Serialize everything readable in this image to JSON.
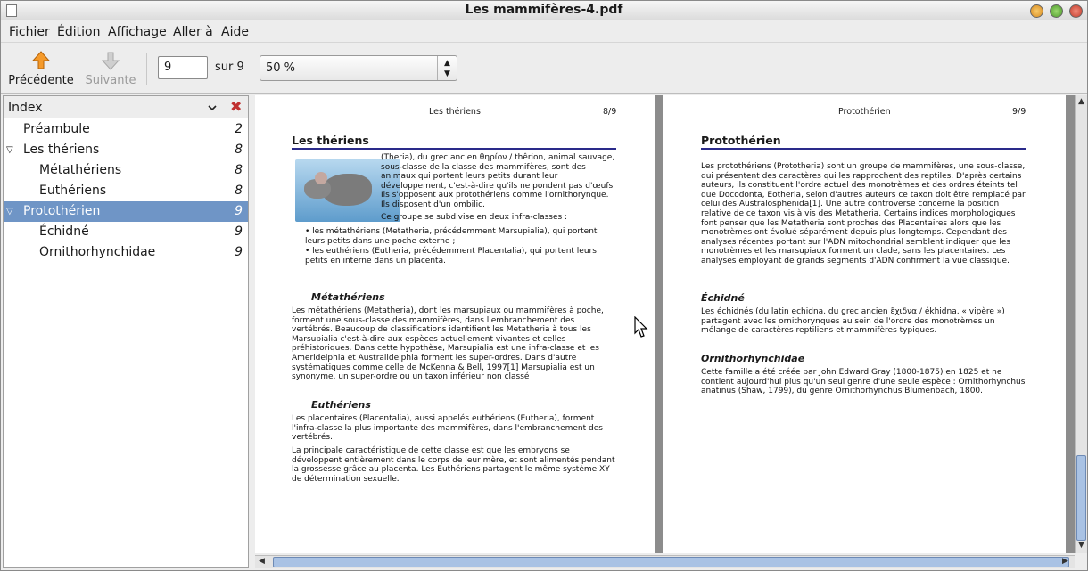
{
  "window": {
    "title": "Les mammifères-4.pdf"
  },
  "menu": [
    "Fichier",
    "Édition",
    "Affichage",
    "Aller à",
    "Aide"
  ],
  "toolbar": {
    "prev_label": "Précédente",
    "next_label": "Suivante",
    "page_value": "9",
    "page_total": "sur 9",
    "zoom_value": "50 %"
  },
  "sidebar": {
    "title": "Index",
    "items": [
      {
        "label": "Préambule",
        "page": "2",
        "level": 0,
        "expander": "",
        "selected": false
      },
      {
        "label": "Les thériens",
        "page": "8",
        "level": 0,
        "expander": "▽",
        "selected": false
      },
      {
        "label": "Métathériens",
        "page": "8",
        "level": 1,
        "expander": "",
        "selected": false
      },
      {
        "label": "Euthériens",
        "page": "8",
        "level": 1,
        "expander": "",
        "selected": false
      },
      {
        "label": "Protothérien",
        "page": "9",
        "level": 0,
        "expander": "▽",
        "selected": true
      },
      {
        "label": "Échidné",
        "page": "9",
        "level": 1,
        "expander": "",
        "selected": false
      },
      {
        "label": "Ornithorhynchidae",
        "page": "9",
        "level": 1,
        "expander": "",
        "selected": false
      }
    ]
  },
  "page8": {
    "header": "Les thériens",
    "pagenum": "8/9",
    "title": "Les thériens",
    "intro": "(Theria), du grec ancien θηρίον / thêrion, animal sauvage, sous-classe de la classe des mammifères, sont des animaux qui portent leurs petits durant leur développement, c'est-à-dire qu'ils ne pondent pas d'œufs. Ils s'opposent aux protothériens comme l'ornithorynque. Ils disposent d'un ombilic.",
    "subdiv": "Ce groupe se subdivise en deux infra-classes :",
    "bullet1": "les métathériens (Metatheria, précédemment Marsupialia), qui portent leurs petits dans une poche externe ;",
    "bullet2": "les euthériens (Eutheria, précédemment Placentalia), qui portent leurs petits en interne dans un placenta.",
    "h_meta": "Métathériens",
    "meta_text": "Les métathériens (Metatheria), dont les marsupiaux ou mammifères à poche, forment une sous-classe des mammifères, dans l'embranchement des vertébrés. Beaucoup de classifications identifient les Metatheria à tous les Marsupialia c'est-à-dire aux espèces actuellement vivantes et celles préhistoriques. Dans cette hypothèse, Marsupialia est une infra-classe et les Ameridelphia et Australidelphia forment les super-ordres. Dans d'autre systématiques comme celle de McKenna & Bell, 1997[1] Marsupialia est un synonyme, un super-ordre ou un taxon inférieur non classé",
    "h_eu": "Euthériens",
    "eu_text1": "Les placentaires (Placentalia), aussi appelés euthériens (Eutheria), forment l'infra-classe la plus importante des mammifères, dans l'embranchement des vertébrés.",
    "eu_text2": "La principale caractéristique de cette classe est que les embryons se développent entièrement dans le corps de leur mère, et sont alimentés pendant la grossesse grâce au placenta. Les Euthériens partagent le même système XY de détermination sexuelle."
  },
  "page9": {
    "header": "Protothérien",
    "pagenum": "9/9",
    "title": "Protothérien",
    "proto_text": "Les protothériens (Prototheria) sont un groupe de mammifères, une sous-classe, qui présentent des caractères qui les rapprochent des reptiles. D'après certains auteurs, ils constituent l'ordre actuel des monotrèmes et des ordres éteints tel que Docodonta, Eotheria, selon d'autres auteurs ce taxon doit être remplacé par celui des Australosphenida[1]. Une autre controverse concerne la position relative de ce taxon vis à vis des Metatheria. Certains indices morphologiques font penser que les Metatheria sont proches des Placentaires alors que les monotrèmes ont évolué séparément depuis plus longtemps. Cependant des analyses récentes portant sur l'ADN mitochondrial semblent indiquer que les monotrèmes et les marsupiaux forment un clade, sans les placentaires. Les analyses employant de grands segments d'ADN confirment la vue classique.",
    "h_echidne": "Échidné",
    "echidne_text": "Les échidnés (du latin echidna, du grec ancien ἔχιδνα / ékhidna, « vipère ») partagent avec les ornithorynques au sein de l'ordre des monotrèmes un mélange de caractères reptiliens et mammifères typiques.",
    "h_ornitho": "Ornithorhynchidae",
    "ornitho_text": "Cette famille a été créée par John Edward Gray (1800-1875) en 1825 et ne contient aujourd'hui plus qu'un seul genre d'une seule espèce : Ornithorhynchus anatinus (Shaw, 1799), du genre Ornithorhynchus Blumenbach, 1800."
  }
}
